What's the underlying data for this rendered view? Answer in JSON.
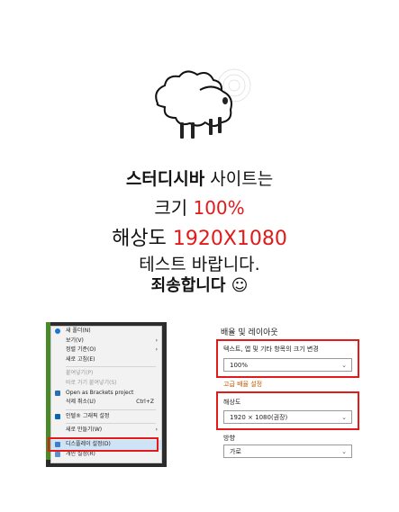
{
  "message": {
    "line1_bold": "스터디시바",
    "line1_rest": " 사이트는",
    "line2_prefix": "크기 ",
    "line2_value": "100%",
    "line3_prefix": "해상도 ",
    "line3_value": "1920X1080",
    "line4": "테스트 바랍니다.",
    "line5": "죄송합니다 ☺"
  },
  "context_menu": {
    "items": [
      {
        "label": "새 폴더(N)",
        "icon": "folder-icon"
      },
      {
        "label": "보기(V)",
        "arrow": "›"
      },
      {
        "label": "정렬 기준(O)",
        "arrow": "›"
      },
      {
        "label": "새로 고침(E)"
      },
      {
        "label": "붙여넣기(P)",
        "disabled": true
      },
      {
        "label": "바로 가기 붙여넣기(S)",
        "disabled": true
      },
      {
        "label": "Open as Brackets project",
        "icon": "brackets-icon"
      },
      {
        "label": "삭제 취소(U)",
        "shortcut": "Ctrl+Z"
      },
      {
        "label": "인텔® 그래픽 설정",
        "icon": "intel-icon"
      },
      {
        "label": "새로 만들기(W)",
        "arrow": "›"
      },
      {
        "label": "디스플레이 설정(D)",
        "icon": "display-icon"
      },
      {
        "label": "개인 설정(R)",
        "icon": "personalize-icon"
      }
    ]
  },
  "settings": {
    "section_title": "배율 및 레이아웃",
    "scale_label": "텍스트, 앱 및 기타 항목의 크기 변경",
    "scale_value": "100%",
    "advanced_link": "고급 배율 설정",
    "resolution_label": "해상도",
    "resolution_value": "1920 × 1080(권장)",
    "orientation_label": "방향",
    "orientation_value": "가로"
  },
  "colors": {
    "highlight": "#e21a1a",
    "link": "#c15a00"
  }
}
